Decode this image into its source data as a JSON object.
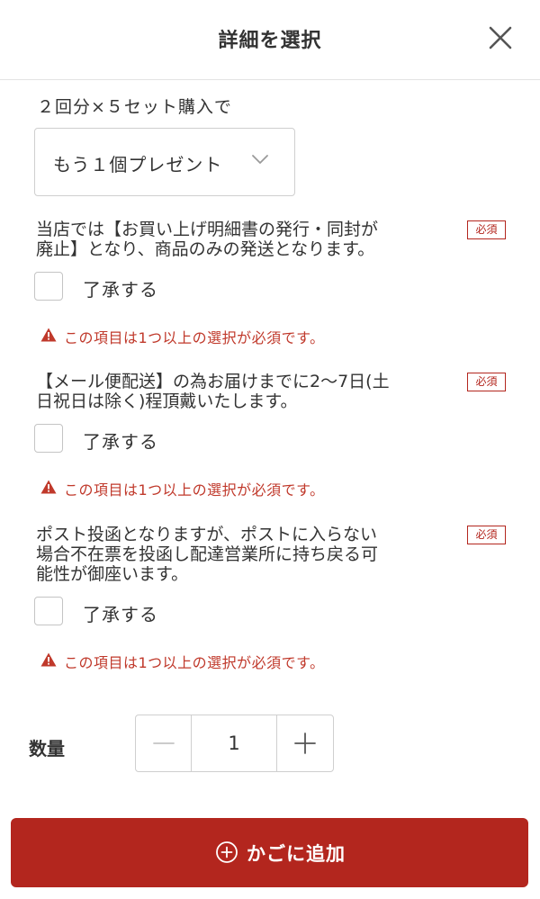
{
  "header": {
    "title": "詳細を選択",
    "close_icon": "close-icon"
  },
  "offer": {
    "label": "２回分×５セット購入で",
    "select_value": "もう１個プレゼント"
  },
  "questions": [
    {
      "lines": [
        "当店では【お買い上げ明細書の発行・同封が",
        "廃止】となり、商品のみの発送となります。"
      ],
      "required": "必須",
      "checkbox_label": "了承する",
      "checked": false,
      "error": "この項目は1つ以上の選択が必須です。"
    },
    {
      "lines": [
        "【メール便配送】の為お届けまでに2〜7日(土",
        "日祝日は除く)程頂戴いたします。"
      ],
      "required": "必須",
      "checkbox_label": "了承する",
      "checked": false,
      "error": "この項目は1つ以上の選択が必須です。"
    },
    {
      "lines": [
        "ポスト投函となりますが、ポストに入らない",
        "場合不在票を投函し配達営業所に持ち戻る可",
        "能性が御座います。"
      ],
      "required": "必須",
      "checkbox_label": "了承する",
      "checked": false,
      "error": "この項目は1つ以上の選択が必須です。"
    }
  ],
  "quantity": {
    "label": "数量",
    "value": "1"
  },
  "cart": {
    "button_label": "かごに追加"
  },
  "colors": {
    "accent": "#b3261e",
    "error": "#c0392b",
    "text": "#333333",
    "border": "#cfcfcf"
  }
}
